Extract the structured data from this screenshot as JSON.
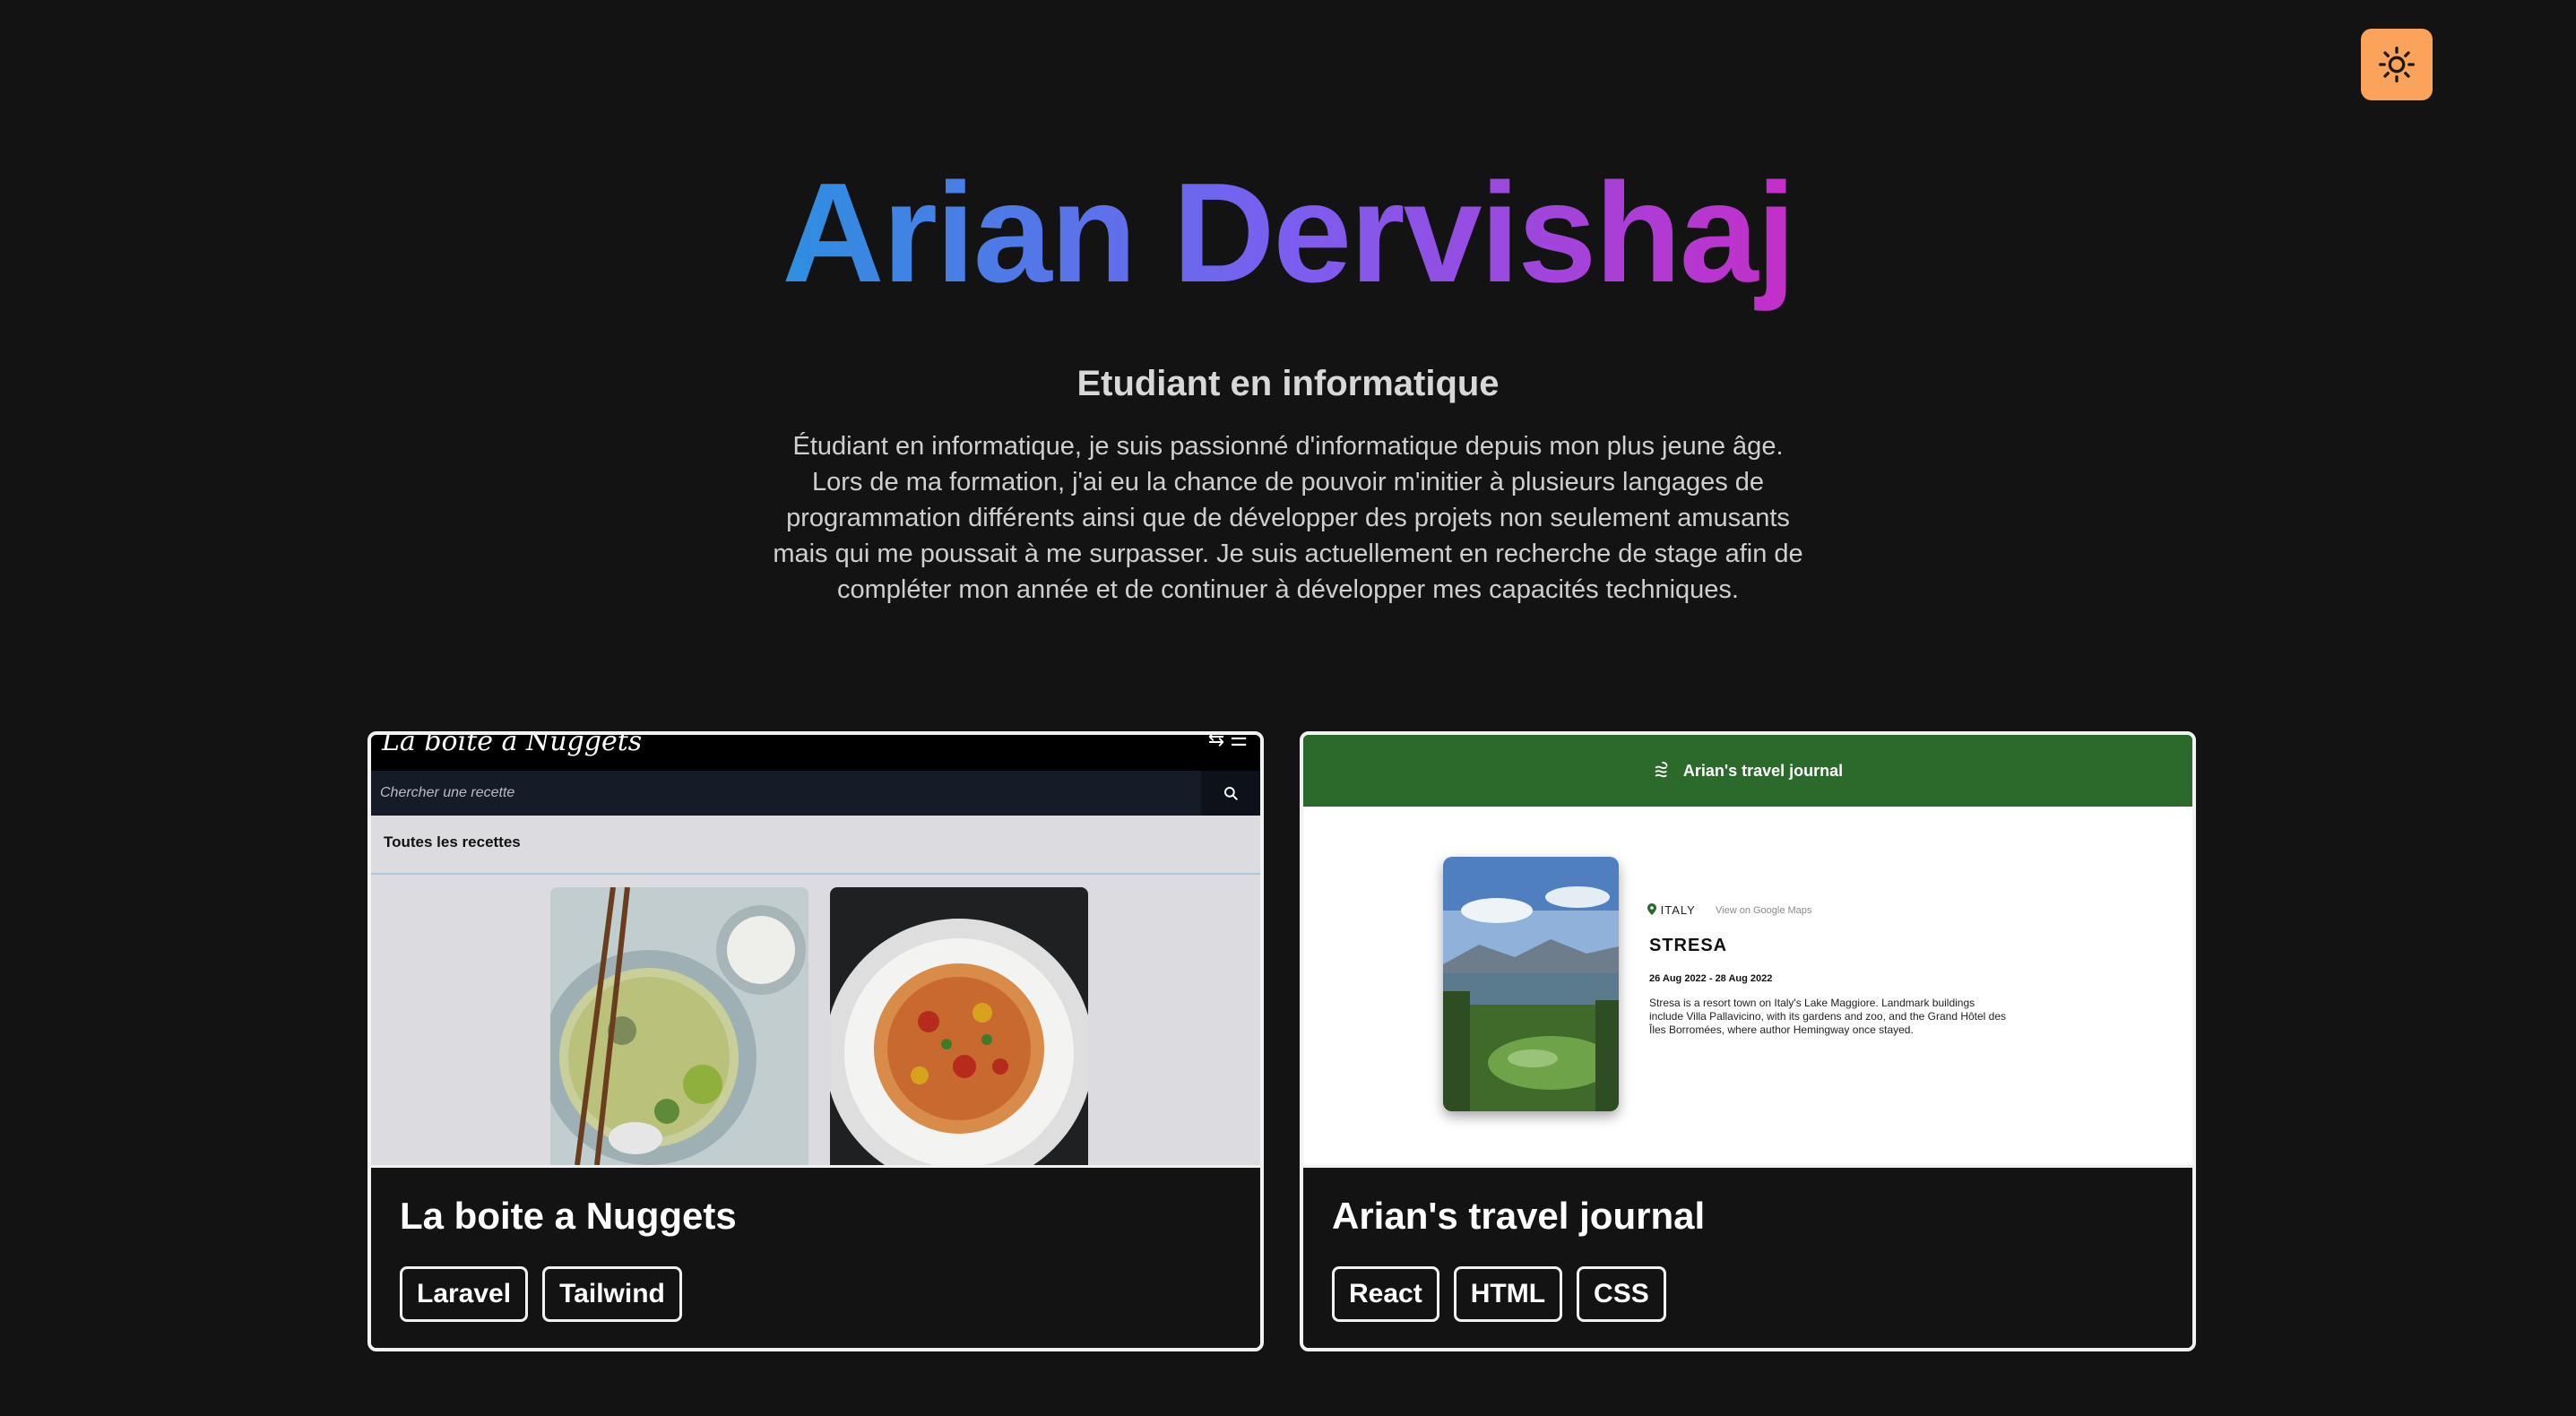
{
  "theme_toggle": {
    "icon": "sun-icon",
    "color": "#fba35a"
  },
  "hero": {
    "name": "Arian Dervishaj",
    "gradient": [
      "#2d8fe0",
      "#7b5ef0",
      "#c42ec8"
    ],
    "subtitle": "Etudiant en informatique",
    "bio": "Étudiant en informatique, je suis passionné d'informatique depuis mon plus jeune âge. Lors de ma formation, j'ai eu la chance de pouvoir m'initier à plusieurs langages de programmation différents ainsi que de développer des projets non seulement amusants mais qui me poussait à me surpasser. Je suis actuellement en recherche de stage afin de compléter mon année et de continuer à développer mes capacités techniques."
  },
  "projects": [
    {
      "title": "La boite a Nuggets",
      "tags": [
        "Laravel",
        "Tailwind"
      ],
      "preview": {
        "logo": "La boite a Nuggets",
        "search_placeholder": "Chercher une recette",
        "heading": "Toutes les recettes"
      }
    },
    {
      "title": "Arian's travel journal",
      "tags": [
        "React",
        "HTML",
        "CSS"
      ],
      "preview": {
        "header_title": "Arian's travel journal",
        "country": "ITALY",
        "maps_link": "View on Google Maps",
        "city": "STRESA",
        "dates": "26 Aug 2022 - 28 Aug 2022",
        "description": "Stresa is a resort town on Italy's Lake Maggiore. Landmark buildings include Villa Pallavicino, with its gardens and zoo, and the Grand Hôtel des Îles Borromées, where author Hemingway once stayed."
      }
    }
  ]
}
